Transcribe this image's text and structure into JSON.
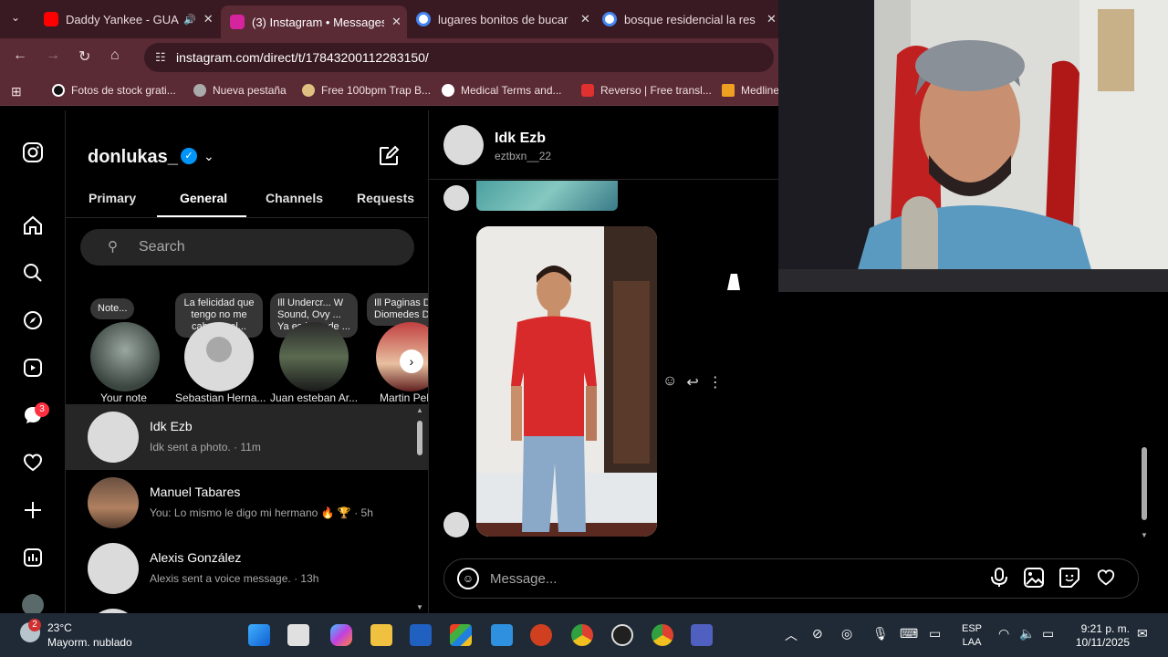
{
  "browser": {
    "tabs": [
      {
        "title": "Daddy Yankee - GUA",
        "color": "#ff0000"
      },
      {
        "title": "(3) Instagram • Messages",
        "color": "#d6249f"
      },
      {
        "title": "lugares bonitos de bucar",
        "color": "#4285f4"
      },
      {
        "title": "bosque residencial la res",
        "color": "#4285f4"
      }
    ],
    "url": "instagram.com/direct/t/17843200112283150/",
    "bookmarks": [
      "Fotos de stock grati...",
      "Nueva pestaña",
      "Free 100bpm Trap B...",
      "Medical Terms and...",
      "Reverso | Free transl...",
      "Medline"
    ]
  },
  "rail": {
    "notification_count": "3"
  },
  "inbox": {
    "username": "donlukas_",
    "tabs": [
      "Primary",
      "General",
      "Channels",
      "Requests"
    ],
    "search_placeholder": "Search",
    "notes": [
      {
        "bubble": "Note...",
        "name": "Your note"
      },
      {
        "bubble": "La felicidad que tengo no me cabe en el...",
        "name": "Sebastian Herna..."
      },
      {
        "bubble": "Ill Undercr... W Sound, Ovy ... Ya es hora de ...",
        "name": "Juan esteban Ar..."
      },
      {
        "bubble": "Ill Paginas D Diomedes D",
        "name": "Martin Pel"
      }
    ],
    "conversations": [
      {
        "name": "Idk Ezb",
        "preview": "Idk sent a photo. · 11m"
      },
      {
        "name": "Manuel Tabares",
        "preview": "You: Lo mismo le digo mi hermano 🔥 🏆 · 5h"
      },
      {
        "name": "Alexis González",
        "preview": "Alexis sent a voice message. · 13h"
      }
    ]
  },
  "thread": {
    "name": "Idk Ezb",
    "handle": "eztbxn__22",
    "message_placeholder": "Message..."
  },
  "taskbar": {
    "weather_temp": "23°C",
    "weather_desc": "Mayorm. nublado",
    "weather_badge": "2",
    "lang_line1": "ESP",
    "lang_line2": "LAA",
    "time": "9:21 p. m.",
    "date": "10/11/2025"
  }
}
